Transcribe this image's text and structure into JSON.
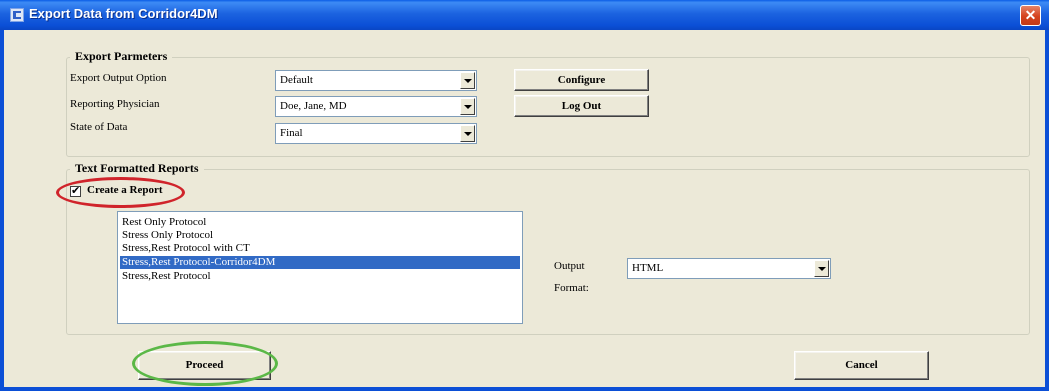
{
  "window": {
    "title": "Export Data from Corridor4DM",
    "close_label": "✕"
  },
  "export_parameters": {
    "legend": "Export Parmeters",
    "export_output_option": {
      "label": "Export Output Option",
      "value": "Default"
    },
    "reporting_physician": {
      "label": "Reporting Physician",
      "value": "Doe, Jane, MD"
    },
    "state_of_data": {
      "label": "State of Data",
      "value": "Final"
    },
    "configure_label": "Configure",
    "logout_label": "Log Out"
  },
  "text_reports": {
    "legend": "Text Formatted Reports",
    "create_report": {
      "label": "Create a Report",
      "checked": true
    },
    "protocols": [
      {
        "label": "Rest Only Protocol",
        "selected": false
      },
      {
        "label": "Stress Only Protocol",
        "selected": false
      },
      {
        "label": "Stress,Rest Protocol with CT",
        "selected": false
      },
      {
        "label": "Stress,Rest Protocol-Corridor4DM",
        "selected": true
      },
      {
        "label": "Stress,Rest Protocol",
        "selected": false
      }
    ],
    "output_format": {
      "label_line1": "Output",
      "label_line2": "Format:",
      "value": "HTML"
    }
  },
  "actions": {
    "proceed_label": "Proceed",
    "cancel_label": "Cancel"
  },
  "highlight_colors": {
    "red": "#D0242B",
    "green": "#5BB847"
  }
}
